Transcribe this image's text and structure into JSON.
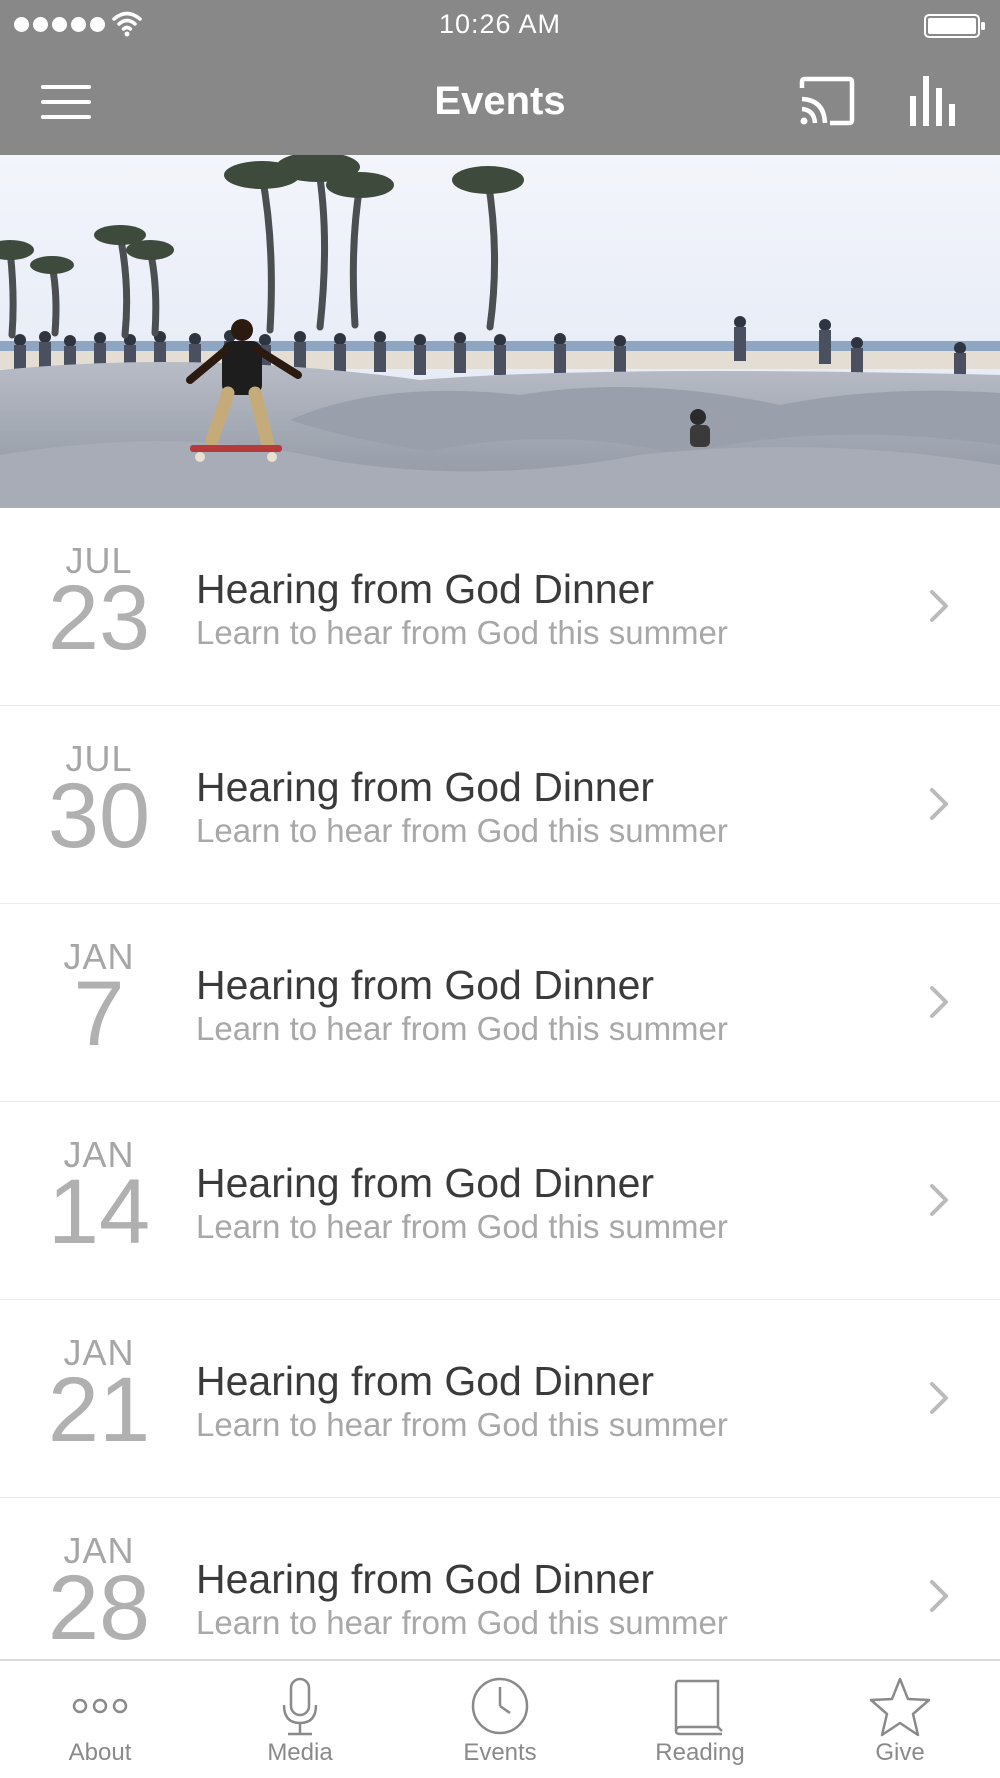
{
  "status_bar": {
    "time": "10:26 AM",
    "signal_bars": 5,
    "battery_level": 1.0
  },
  "nav_bar": {
    "title": "Events"
  },
  "hero": {
    "icon": "skatepark-photo"
  },
  "events": [
    {
      "month": "JUL",
      "day": "23",
      "title": "Hearing from God Dinner",
      "subtitle": "Learn to hear from God this summer"
    },
    {
      "month": "JUL",
      "day": "30",
      "title": "Hearing from God Dinner",
      "subtitle": "Learn to hear from God this summer"
    },
    {
      "month": "JAN",
      "day": "7",
      "title": "Hearing from God Dinner",
      "subtitle": "Learn to hear from God this summer"
    },
    {
      "month": "JAN",
      "day": "14",
      "title": "Hearing from God Dinner",
      "subtitle": "Learn to hear from God this summer"
    },
    {
      "month": "JAN",
      "day": "21",
      "title": "Hearing from God Dinner",
      "subtitle": "Learn to hear from God this summer"
    },
    {
      "month": "JAN",
      "day": "28",
      "title": "Hearing from God Dinner",
      "subtitle": "Learn to hear from God this summer"
    }
  ],
  "tab_bar": {
    "tabs": [
      {
        "label": "About",
        "icon": "more-dots-icon"
      },
      {
        "label": "Media",
        "icon": "microphone-icon"
      },
      {
        "label": "Events",
        "icon": "clock-icon"
      },
      {
        "label": "Reading",
        "icon": "book-icon"
      },
      {
        "label": "Give",
        "icon": "star-icon"
      }
    ]
  },
  "colors": {
    "bar_gray": "#888888",
    "text_dark": "#3a3a3a",
    "text_light": "#a8a8a8"
  }
}
